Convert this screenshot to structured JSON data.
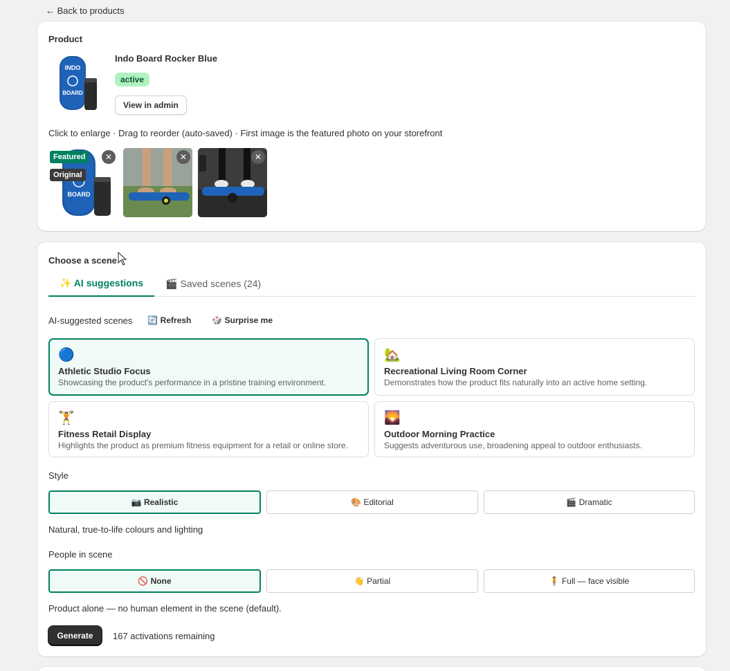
{
  "nav": {
    "back_label": "← Back to products"
  },
  "product": {
    "section_title": "Product",
    "name": "Indo Board Rocker Blue",
    "status": "active",
    "view_admin_label": "View in admin",
    "hint": "Click to enlarge · Drag to reorder (auto-saved) · First image is the featured photo on your storefront",
    "gallery": [
      {
        "featured_label": "Featured",
        "original_label": "Original",
        "remove_label": "✕"
      },
      {
        "remove_label": "✕"
      },
      {
        "remove_label": "✕"
      }
    ]
  },
  "scene": {
    "section_title": "Choose a scene",
    "tabs": [
      {
        "label": "✨ AI suggestions",
        "active": true
      },
      {
        "label": "🎬 Saved scenes (24)",
        "active": false
      }
    ],
    "suggestions_label": "AI-suggested scenes",
    "refresh_label": "🔄 Refresh",
    "surprise_label": "🎲 Surprise me",
    "scenes": [
      {
        "emoji": "🔵",
        "title": "Athletic Studio Focus",
        "desc": "Showcasing the product's performance in a pristine training environment.",
        "selected": true
      },
      {
        "emoji": "🏡",
        "title": "Recreational Living Room Corner",
        "desc": "Demonstrates how the product fits naturally into an active home setting.",
        "selected": false
      },
      {
        "emoji": "🏋",
        "title": "Fitness Retail Display",
        "desc": "Highlights the product as premium fitness equipment for a retail or online store.",
        "selected": false
      },
      {
        "emoji": "🌄",
        "title": "Outdoor Morning Practice",
        "desc": "Suggests adventurous use, broadening appeal to outdoor enthusiasts.",
        "selected": false
      }
    ],
    "style_label": "Style",
    "styles": [
      {
        "label": "📷 Realistic",
        "selected": true
      },
      {
        "label": "🎨 Editorial",
        "selected": false
      },
      {
        "label": "🎬 Dramatic",
        "selected": false
      }
    ],
    "style_help": "Natural, true-to-life colours and lighting",
    "people_label": "People in scene",
    "people": [
      {
        "label": "🚫 None",
        "selected": true
      },
      {
        "label": "👋 Partial",
        "selected": false
      },
      {
        "label": "🧍 Full — face visible",
        "selected": false
      }
    ],
    "people_help": "Product alone — no human element in the scene (default).",
    "generate_label": "Generate",
    "activations": "167 activations remaining"
  },
  "colors": {
    "accent": "#008060",
    "accent_bg": "#f0faf7",
    "badge_bg": "#aff2c0",
    "primary_btn": "#303030"
  }
}
